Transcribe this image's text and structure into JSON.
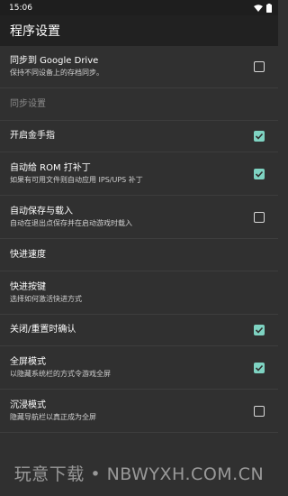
{
  "status_bar": {
    "time": "15:06"
  },
  "header": {
    "title": "程序设置"
  },
  "settings": [
    {
      "title": "同步到 Google Drive",
      "summary": "保持不同设备上的存档同步。",
      "checkbox": false
    },
    {
      "title": "同步设置",
      "summary": "",
      "category": true
    },
    {
      "title": "开启金手指",
      "summary": "",
      "checkbox": true
    },
    {
      "title": "自动给 ROM 打补丁",
      "summary": "如果有可用文件则自动应用 IPS/UPS 补丁",
      "checkbox": true
    },
    {
      "title": "自动保存与载入",
      "summary": "自动在退出点保存并在启动游戏时载入",
      "checkbox": false
    },
    {
      "title": "快进速度",
      "summary": ""
    },
    {
      "title": "快进按键",
      "summary": "选择如何激活快进方式"
    },
    {
      "title": "关闭/重置时确认",
      "summary": "",
      "checkbox": true
    },
    {
      "title": "全屏模式",
      "summary": "以隐藏系统栏的方式令游戏全屏",
      "checkbox": true
    },
    {
      "title": "沉浸模式",
      "summary": "隐藏导航栏以真正成为全屏",
      "checkbox": false
    }
  ],
  "watermark": "玩意下载 • NBWYXH.COM.CN",
  "colors": {
    "accent": "#7ed3c2",
    "background": "#303030",
    "appbar": "#212121"
  }
}
